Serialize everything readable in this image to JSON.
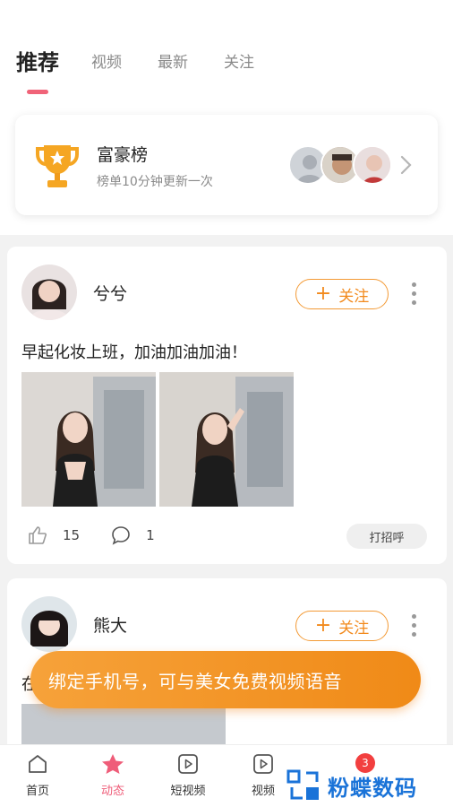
{
  "tabs": [
    {
      "label": "推荐",
      "active": true
    },
    {
      "label": "视频",
      "active": false
    },
    {
      "label": "最新",
      "active": false
    },
    {
      "label": "关注",
      "active": false
    }
  ],
  "rich_list": {
    "title": "富豪榜",
    "subtitle": "榜单10分钟更新一次",
    "icon": "trophy-icon"
  },
  "posts": [
    {
      "username": "兮兮",
      "follow_label": "关注",
      "text": "早起化妆上班，加油加油加油！",
      "likes": "15",
      "comments": "1",
      "greet_label": "打招呼"
    },
    {
      "username": "熊大",
      "follow_label": "关注",
      "text": "在"
    }
  ],
  "banner": {
    "text": "绑定手机号，可与美女免费视频语音"
  },
  "bottom_nav": [
    {
      "label": "首页",
      "icon": "home-icon",
      "active": false
    },
    {
      "label": "动态",
      "icon": "star-icon",
      "active": true
    },
    {
      "label": "短视频",
      "icon": "play-icon",
      "active": false
    },
    {
      "label": "视频",
      "icon": "video-icon",
      "active": false
    }
  ],
  "message_badge": "3",
  "watermark": {
    "text": "粉蝶数码"
  },
  "colors": {
    "accent_pink": "#ef5d79",
    "follow_orange": "#f28a1d",
    "banner_orange": "#f08a17"
  }
}
